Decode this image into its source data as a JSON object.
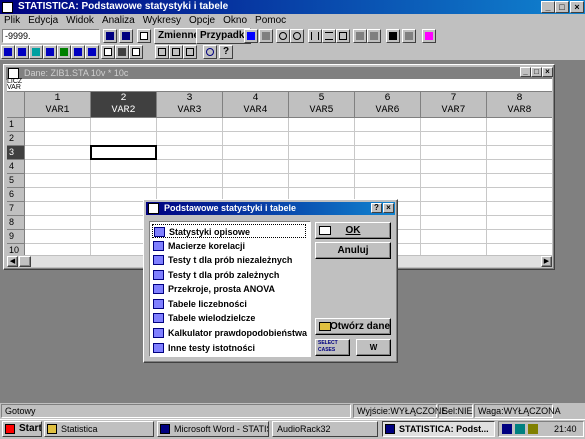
{
  "app": {
    "title": "STATISTICA: Podstawowe statystyki i tabele"
  },
  "menu": [
    "Plik",
    "Edycja",
    "Widok",
    "Analiza",
    "Wykresy",
    "Opcje",
    "Okno",
    "Pomoc"
  ],
  "toolbar": {
    "field_value": "-9999.",
    "zmienne_label": "Zmienne",
    "przypadki_label": "Przypadki"
  },
  "data_window": {
    "title": "Dane: ZIB1.STA 10v * 10c",
    "top_left_text": "LICZ\nVAR",
    "columns": [
      {
        "num": "1",
        "name": "VAR1"
      },
      {
        "num": "2",
        "name": "VAR2"
      },
      {
        "num": "3",
        "name": "VAR3"
      },
      {
        "num": "4",
        "name": "VAR4"
      },
      {
        "num": "5",
        "name": "VAR5"
      },
      {
        "num": "6",
        "name": "VAR6"
      },
      {
        "num": "7",
        "name": "VAR7"
      },
      {
        "num": "8",
        "name": "VAR8"
      }
    ],
    "rows": [
      "1",
      "2",
      "3",
      "4",
      "5",
      "6",
      "7",
      "8",
      "9",
      "10"
    ]
  },
  "dialog": {
    "title": "Podstawowe statystyki i tabele",
    "items": [
      "Statystyki opisowe",
      "Macierze korelacji",
      "Testy t dla prób niezależnych",
      "Testy t dla prób zależnych",
      "Przekroje, prosta ANOVA",
      "Tabele liczebności",
      "Tabele wielodzielcze",
      "Kalkulator prawdopodobieństwa",
      "Inne testy istotności"
    ],
    "ok_label": "OK",
    "cancel_label": "Anuluj",
    "open_data_label": "Otwórz dane",
    "select_cases_label": "SELECT CASES",
    "w_label": "W"
  },
  "statusbar": {
    "ready": "Gotowy",
    "wyjscie": "Wyjście:WYŁĄCZONE",
    "sel": "Sel:NIE",
    "waga": "Waga:WYŁĄCZONA"
  },
  "taskbar": {
    "start": "Start",
    "tasks": [
      "Statistica",
      "Microsoft Word - STATIS...",
      "AudioRack32",
      "STATISTICA: Podst..."
    ],
    "clock": "21:40"
  }
}
